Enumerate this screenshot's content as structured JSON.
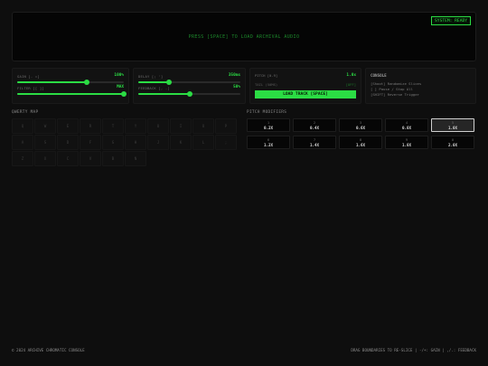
{
  "waveform": {
    "prompt": "PRESS [SPACE] TO LOAD ARCHIVAL AUDIO",
    "status": "SYSTEM: READY"
  },
  "controls": {
    "left": [
      {
        "label": "GAIN [- =]",
        "value": "100%",
        "level": 0.65
      },
      {
        "label": "FILTER [[ ]]",
        "value": "MAX",
        "level": 1.0
      }
    ],
    "mid": [
      {
        "label": "DELAY [; ']",
        "value": "350ms",
        "level": 0.3
      },
      {
        "label": "FEEDBACK [, .]",
        "value": "50%",
        "level": 0.5
      }
    ],
    "pitch": {
      "label": "PITCH [0-9]",
      "value": "1.0x"
    },
    "tail": {
      "label": "TAIL (50MS)",
      "value": "[OFF]"
    },
    "load_button": "LOAD TRACK [SPACE]",
    "console": {
      "title": "CONSOLE",
      "lines": [
        "[Shoot] Randomize Slices",
        "[ ] Pause / Stop All",
        "[SHIFT] Reverse Trigger"
      ]
    }
  },
  "qwerty": {
    "title": "QWERTY MAP",
    "keys": [
      "Q",
      "W",
      "E",
      "R",
      "T",
      "Y",
      "U",
      "I",
      "O",
      "P",
      "A",
      "S",
      "D",
      "F",
      "G",
      "H",
      "J",
      "K",
      "L",
      ";",
      "Z",
      "X",
      "C",
      "V",
      "B",
      "N"
    ]
  },
  "pitch_mods": {
    "title": "PITCH MODIFIERS",
    "buttons": [
      {
        "key": "1",
        "value": "0.2X"
      },
      {
        "key": "2",
        "value": "0.4X"
      },
      {
        "key": "3",
        "value": "0.6X"
      },
      {
        "key": "4",
        "value": "0.8X"
      },
      {
        "key": "5",
        "value": "1.0X",
        "active": true
      },
      {
        "key": "6",
        "value": "1.2X"
      },
      {
        "key": "7",
        "value": "1.4X"
      },
      {
        "key": "8",
        "value": "1.6X"
      },
      {
        "key": "9",
        "value": "1.8X"
      },
      {
        "key": "0",
        "value": "2.0X"
      }
    ]
  },
  "footer": {
    "left": "© 2024 ARCHIVE CHROMATIC CONSOLE",
    "right": "DRAG BOUNDARIES TO RE-SLICE | -/+: GAIN | ,/.: FEEDBACK"
  },
  "colors": {
    "accent": "#2bdc44",
    "background": "#0e0e0e"
  }
}
